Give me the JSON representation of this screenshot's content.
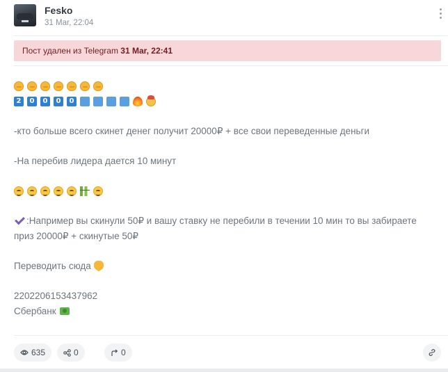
{
  "post": {
    "author": "Fesko",
    "date": "31 Mar, 22:04",
    "deleted_notice_prefix": "Пост удален из Telegram",
    "deleted_notice_date": "31 Mar, 22:41",
    "keycaps": [
      "2",
      "0",
      "0",
      "0",
      "0"
    ],
    "lines": {
      "rule1": "-кто больше всего скинет денег получит 20000₽ + все свои переведенные деньги",
      "rule2": "-На перебив лидера дается 10 минут",
      "example_line1": ":Например вы скинули 50₽ и вашу ставку не перебили в течении 10 мин то вы забираете",
      "example_line2": "приз 20000₽ + скинутые 50₽",
      "transfer": "Переводить сюда",
      "account": "2202206153437962",
      "bank": "Сбербанк"
    },
    "stats": {
      "views": "635",
      "shares": "0",
      "forwards": "0"
    }
  },
  "icons": {
    "views": "eye-icon",
    "shares": "share-icon",
    "forwards": "forward-arrow-icon",
    "link": "link-icon",
    "menu": "more-vertical-icon"
  },
  "colors": {
    "alert_bg": "#f8d7da",
    "alert_text": "#721c24",
    "text": "#6c757d",
    "author": "#343a40"
  }
}
